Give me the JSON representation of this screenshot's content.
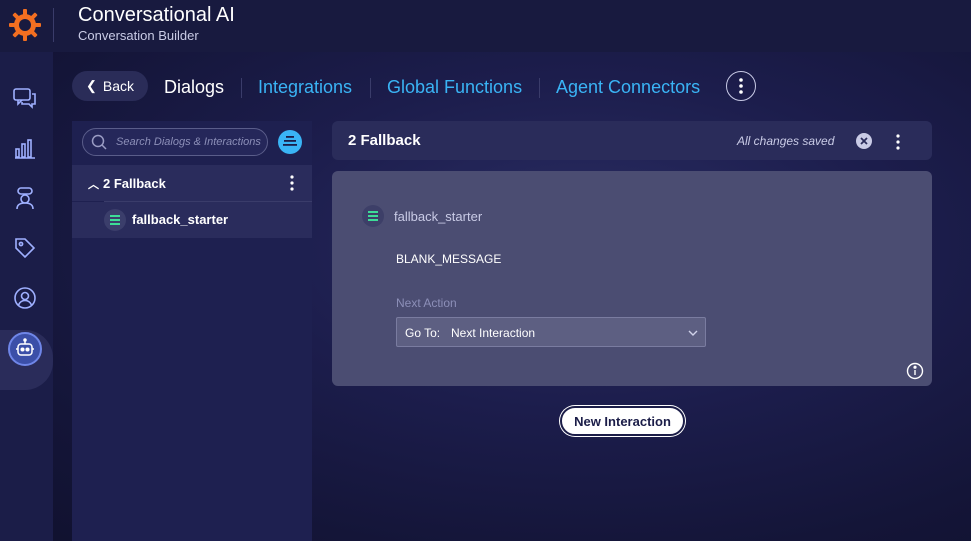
{
  "app": {
    "title": "Conversational AI",
    "subtitle": "Conversation Builder",
    "logo_icon": "sun-gear-logo-icon",
    "accent_color": "#3ab4f5",
    "brand_color": "#f36f21"
  },
  "leftnav": {
    "items": [
      {
        "name": "messaging-icon"
      },
      {
        "name": "analytics-icon"
      },
      {
        "name": "agent-icon"
      },
      {
        "name": "tags-icon"
      },
      {
        "name": "profile-icon"
      },
      {
        "name": "bot-icon",
        "active": true
      }
    ]
  },
  "toolbar": {
    "back_label": "Back",
    "tabs": [
      {
        "label": "Dialogs",
        "active": true
      },
      {
        "label": "Integrations",
        "active": false
      },
      {
        "label": "Global Functions",
        "active": false
      },
      {
        "label": "Agent Connectors",
        "active": false
      }
    ],
    "more_icon": "more-vertical-icon"
  },
  "sidebar": {
    "search_placeholder": "Search Dialogs & Interactions",
    "filter_icon": "filter-icon",
    "group": {
      "label": "2 Fallback",
      "expanded": true
    },
    "items": [
      {
        "label": "fallback_starter",
        "icon": "text-message-icon"
      }
    ]
  },
  "dialog": {
    "title": "2 Fallback",
    "status": "All changes saved",
    "close_icon": "close-icon",
    "more_icon": "more-vertical-icon"
  },
  "interaction": {
    "name": "fallback_starter",
    "message": "BLANK_MESSAGE",
    "next_action_label": "Next Action",
    "select_prefix": "Go To:",
    "select_value": "Next Interaction",
    "info_icon": "info-icon"
  },
  "actions": {
    "new_interaction_label": "New Interaction"
  }
}
